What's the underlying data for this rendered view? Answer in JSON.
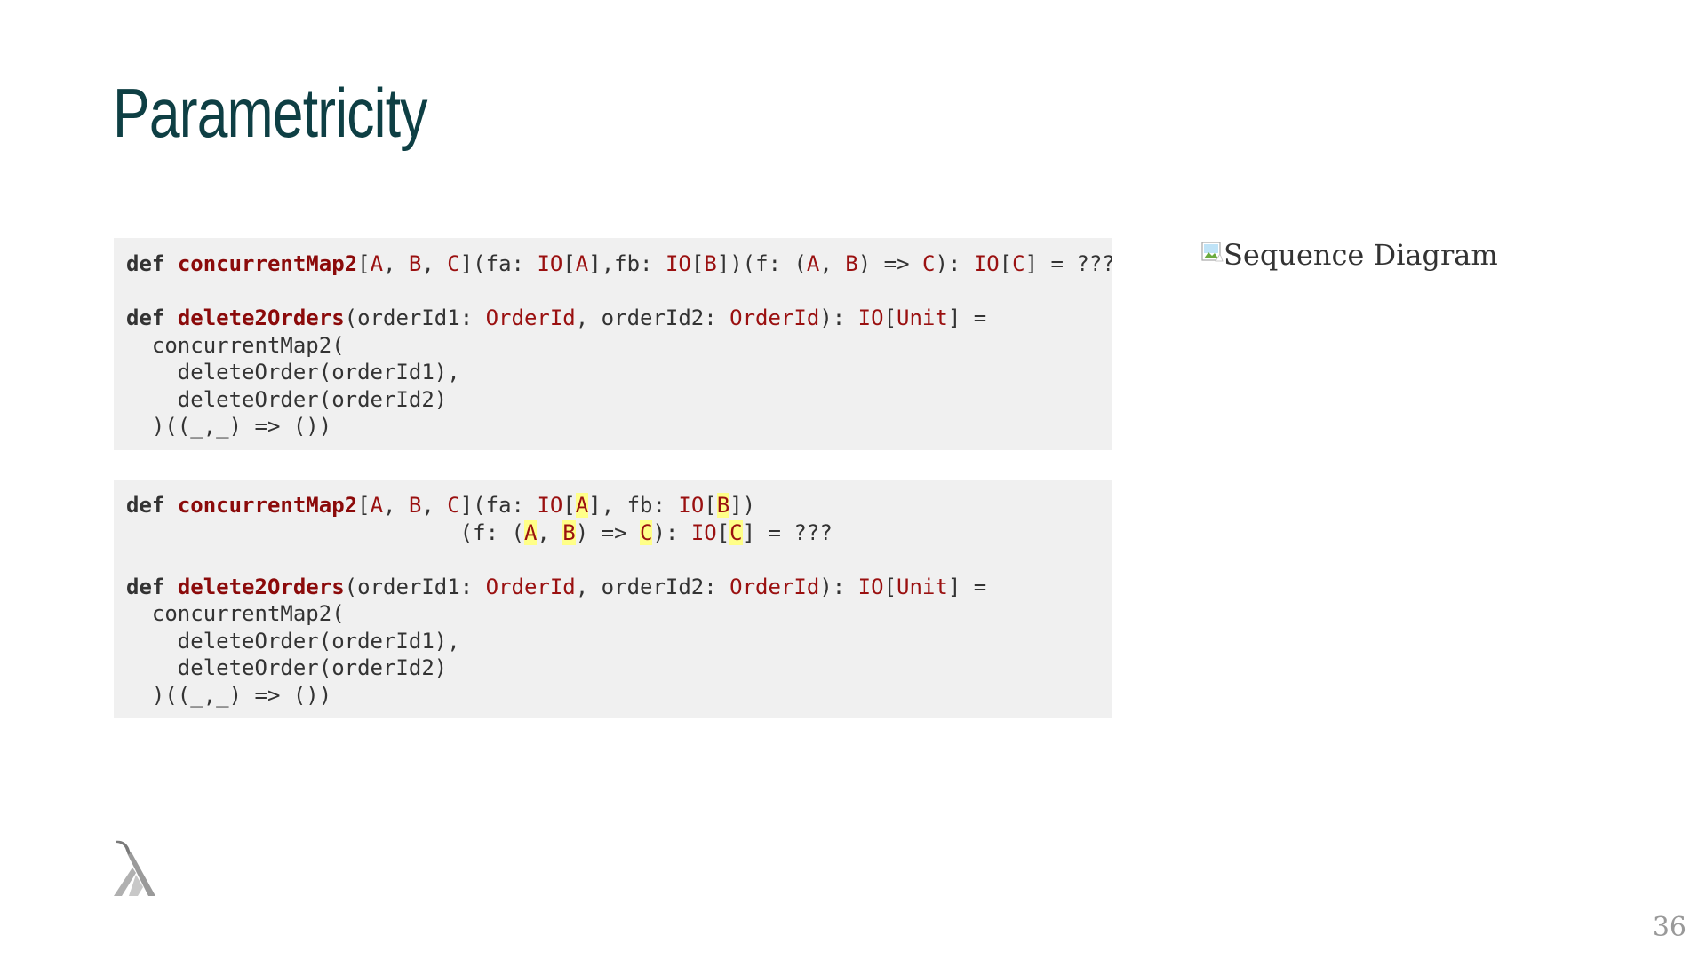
{
  "slide": {
    "title": "Parametricity",
    "image_alt": "Sequence Diagram",
    "page_number": "36",
    "icons": [
      "broken-image-icon",
      "lambda-logo"
    ]
  },
  "colors": {
    "title": "#0e3f44",
    "code_background": "#f0f0f0",
    "function_name": "#8b0a0a",
    "type_name": "#9a1010",
    "highlight": "#ffff88"
  },
  "code_blocks": [
    {
      "lines": [
        [
          {
            "t": "def",
            "s": "kw"
          },
          {
            "t": " "
          },
          {
            "t": "concurrentMap2",
            "s": "fn"
          },
          {
            "t": "["
          },
          {
            "t": "A",
            "s": "ty"
          },
          {
            "t": ", "
          },
          {
            "t": "B",
            "s": "ty"
          },
          {
            "t": ", "
          },
          {
            "t": "C",
            "s": "ty"
          },
          {
            "t": "](fa: "
          },
          {
            "t": "IO",
            "s": "ty"
          },
          {
            "t": "["
          },
          {
            "t": "A",
            "s": "ty"
          },
          {
            "t": "],fb: "
          },
          {
            "t": "IO",
            "s": "ty"
          },
          {
            "t": "["
          },
          {
            "t": "B",
            "s": "ty"
          },
          {
            "t": "])(f: ("
          },
          {
            "t": "A",
            "s": "ty"
          },
          {
            "t": ", "
          },
          {
            "t": "B",
            "s": "ty"
          },
          {
            "t": ") => "
          },
          {
            "t": "C",
            "s": "ty"
          },
          {
            "t": "): "
          },
          {
            "t": "IO",
            "s": "ty"
          },
          {
            "t": "["
          },
          {
            "t": "C",
            "s": "ty"
          },
          {
            "t": "] = ???"
          }
        ],
        [],
        [
          {
            "t": "def",
            "s": "kw"
          },
          {
            "t": " "
          },
          {
            "t": "delete2Orders",
            "s": "fn"
          },
          {
            "t": "(orderId1: "
          },
          {
            "t": "OrderId",
            "s": "ty"
          },
          {
            "t": ", orderId2: "
          },
          {
            "t": "OrderId",
            "s": "ty"
          },
          {
            "t": "): "
          },
          {
            "t": "IO",
            "s": "ty"
          },
          {
            "t": "["
          },
          {
            "t": "Unit",
            "s": "ty"
          },
          {
            "t": "] ="
          }
        ],
        [
          {
            "t": "  concurrentMap2("
          }
        ],
        [
          {
            "t": "    deleteOrder(orderId1),"
          }
        ],
        [
          {
            "t": "    deleteOrder(orderId2)"
          }
        ],
        [
          {
            "t": "  )((_,_) => ())"
          }
        ]
      ]
    },
    {
      "lines": [
        [
          {
            "t": "def",
            "s": "kw"
          },
          {
            "t": " "
          },
          {
            "t": "concurrentMap2",
            "s": "fn"
          },
          {
            "t": "["
          },
          {
            "t": "A",
            "s": "ty"
          },
          {
            "t": ", "
          },
          {
            "t": "B",
            "s": "ty"
          },
          {
            "t": ", "
          },
          {
            "t": "C",
            "s": "ty"
          },
          {
            "t": "](fa: "
          },
          {
            "t": "IO",
            "s": "ty"
          },
          {
            "t": "["
          },
          {
            "t": "A",
            "s": "hl"
          },
          {
            "t": "], fb: "
          },
          {
            "t": "IO",
            "s": "ty"
          },
          {
            "t": "["
          },
          {
            "t": "B",
            "s": "hl"
          },
          {
            "t": "])"
          }
        ],
        [
          {
            "t": "                          (f: ("
          },
          {
            "t": "A",
            "s": "hl"
          },
          {
            "t": ", "
          },
          {
            "t": "B",
            "s": "hl"
          },
          {
            "t": ") => "
          },
          {
            "t": "C",
            "s": "hl"
          },
          {
            "t": "): "
          },
          {
            "t": "IO",
            "s": "ty"
          },
          {
            "t": "["
          },
          {
            "t": "C",
            "s": "hl"
          },
          {
            "t": "] = ???"
          }
        ],
        [],
        [
          {
            "t": "def",
            "s": "kw"
          },
          {
            "t": " "
          },
          {
            "t": "delete2Orders",
            "s": "fn"
          },
          {
            "t": "(orderId1: "
          },
          {
            "t": "OrderId",
            "s": "ty"
          },
          {
            "t": ", orderId2: "
          },
          {
            "t": "OrderId",
            "s": "ty"
          },
          {
            "t": "): "
          },
          {
            "t": "IO",
            "s": "ty"
          },
          {
            "t": "["
          },
          {
            "t": "Unit",
            "s": "ty"
          },
          {
            "t": "] ="
          }
        ],
        [
          {
            "t": "  concurrentMap2("
          }
        ],
        [
          {
            "t": "    deleteOrder(orderId1),"
          }
        ],
        [
          {
            "t": "    deleteOrder(orderId2)"
          }
        ],
        [
          {
            "t": "  )((_,_) => ())"
          }
        ]
      ]
    }
  ]
}
